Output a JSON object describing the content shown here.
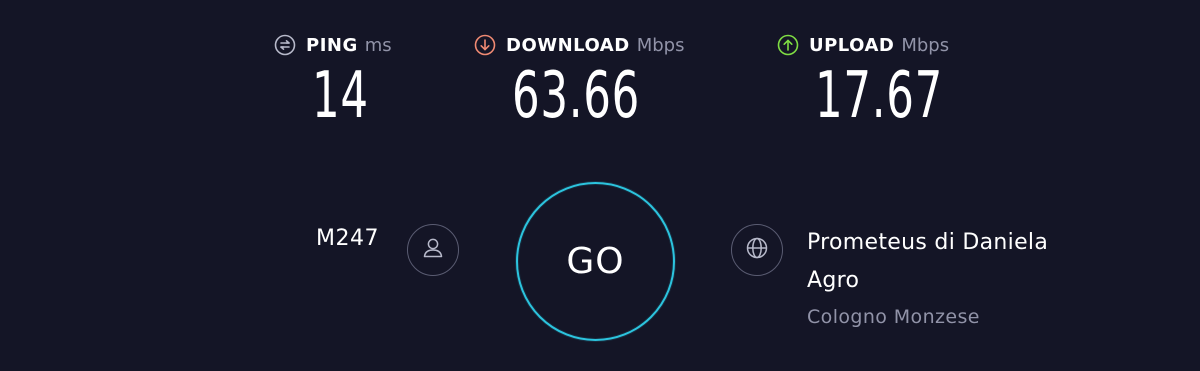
{
  "metrics": {
    "ping": {
      "label": "PING",
      "unit": "ms",
      "value": "14",
      "icon": "ping-icon",
      "icon_color": "#b7b9ca"
    },
    "download": {
      "label": "DOWNLOAD",
      "unit": "Mbps",
      "value": "63.66",
      "icon": "download-arrow-icon",
      "icon_color": "#f08a73"
    },
    "upload": {
      "label": "UPLOAD",
      "unit": "Mbps",
      "value": "17.67",
      "icon": "upload-arrow-icon",
      "icon_color": "#7fdd43"
    }
  },
  "isp": {
    "name": "M247",
    "icon": "user-icon"
  },
  "go_button": {
    "label": "GO",
    "ring_color": "#2cc4de"
  },
  "server": {
    "name": "Prometeus di Daniela Agro",
    "location": "Cologno Monzese",
    "icon": "globe-icon"
  },
  "colors": {
    "background": "#141526",
    "muted_text": "#9193a8",
    "circle_border": "#5a5c72"
  }
}
